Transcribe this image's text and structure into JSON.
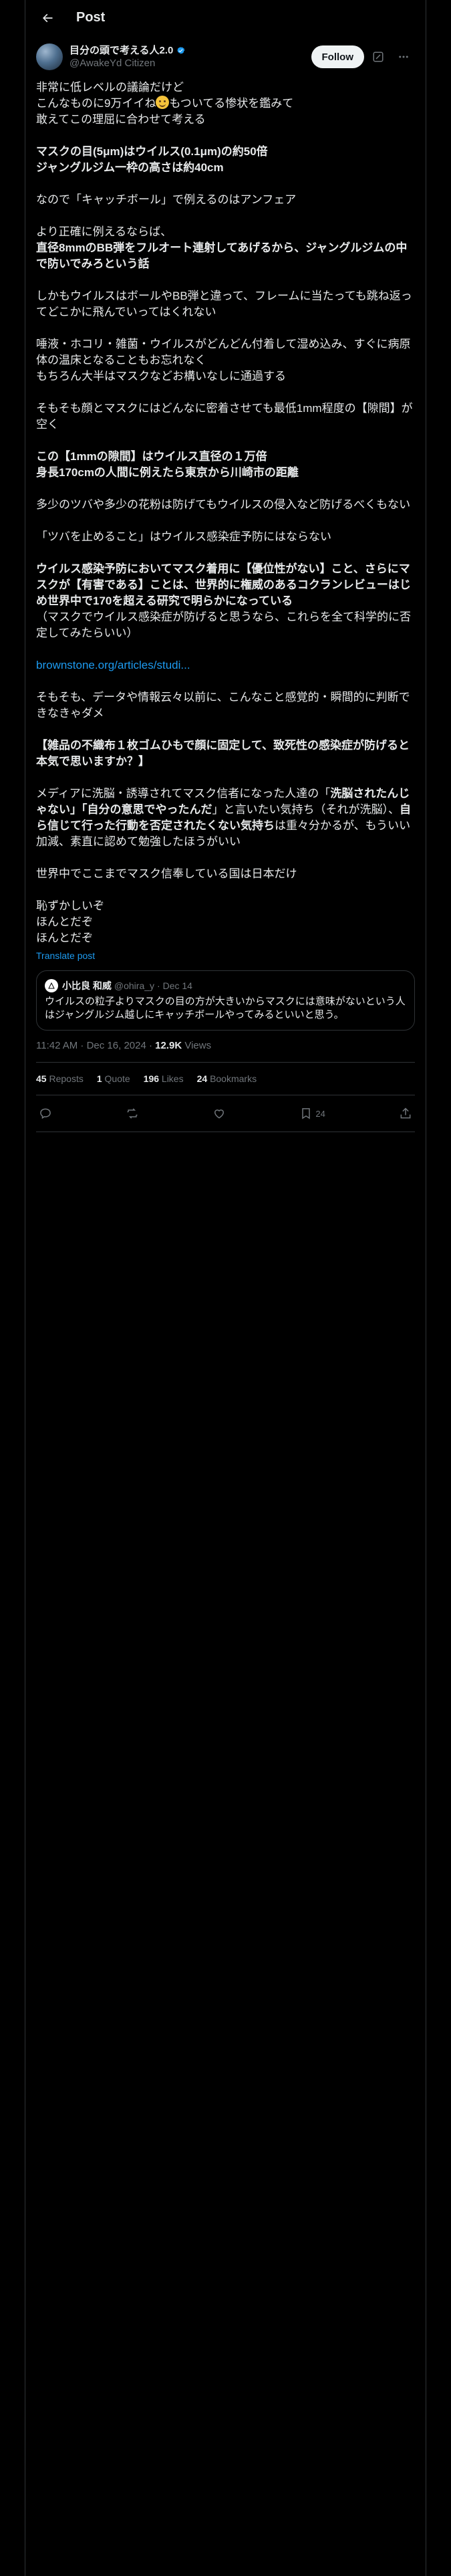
{
  "header": {
    "title": "Post"
  },
  "author": {
    "name": "目分の頭で考える人2.0",
    "handle": "@AwakeYd Citizen"
  },
  "follow_label": "Follow",
  "tweet": {
    "p1_l1": "非常に低レベルの議論だけど",
    "p1_l2a": "こんなものに9万イイね",
    "p1_l2b": "もついてる惨状を鑑みて",
    "p1_l3": "敢えてこの理屈に合わせて考える",
    "p2_l1": "マスクの目(5μm)はウイルス(0.1μm)の約50倍",
    "p2_l2": "ジャングルジム一枠の高さは約40cm",
    "p3": "なので「キャッチボール」で例えるのはアンフェア",
    "p4_l1": "より正確に例えるならば、",
    "p4_l2": "直径8mmのBB弾をフルオート連射してあげるから、ジャングルジムの中で防いでみろという話",
    "p5": "しかもウイルスはボールやBB弾と違って、フレームに当たっても跳ね返ってどこかに飛んでいってはくれない",
    "p6_l1": "唾液・ホコリ・雑菌・ウイルスがどんどん付着して湿め込み、すぐに病原体の温床となることもお忘れなく",
    "p6_l2": "もちろん大半はマスクなどお構いなしに通過する",
    "p7": "そもそも顔とマスクにはどんなに密着させても最低1mm程度の【隙間】が空く",
    "p8_l1": "この【1mmの隙間】はウイルス直径の１万倍",
    "p8_l2": "身長170cmの人間に例えたら東京から川崎市の距離",
    "p9": "多少のツバや多少の花粉は防げてもウイルスの侵入など防げるべくもない",
    "p10": "「ツバを止めること」はウイルス感染症予防にはならない",
    "p11_l1": "ウイルス感染予防においてマスク着用に【優位性がない】こと、さらにマスクが【有害である】ことは、世界的に権威のあるコクランレビューはじめ世界中で170を超える研究で明らかになっている",
    "p11_l2": "（マスクでウイルス感染症が防げると思うなら、これらを全て科学的に否定してみたらいい）",
    "link": "brownstone.org/articles/studi...",
    "p12": "そもそも、データや情報云々以前に、こんなこと感覚的・瞬間的に判断できなきゃダメ",
    "p13": "【雑品の不織布１枚ゴムひもで顔に固定して、致死性の感染症が防げると本気で思いますか？】",
    "p14a": "メディアに洗脳・誘導されてマスク信者になった人達の「",
    "p14b": "洗脳されたんじゃない」「自分の意思でやったんだ",
    "p14c": "」と言いたい気持ち（それが洗脳）、",
    "p14d": "自ら信じて行った行動を否定されたくない気持ち",
    "p14e": "は重々分かるが、もういい加減、素直に認めて勉強したほうがいい",
    "p15": "世界中でここまでマスク信奉している国は日本だけ",
    "p16_l1": "恥ずかしいぞ",
    "p16_l2": "ほんとだぞ",
    "p16_l3": "ほんとだぞ"
  },
  "translate_label": "Translate post",
  "quote": {
    "name": "小比良 和威",
    "handle": "@ohira_y",
    "date": "· Dec 14",
    "text": "ウイルスの粒子よりマスクの目の方が大きいからマスクには意味がないという人はジャングルジム越しにキャッチボールやってみるといいと思う。"
  },
  "meta": {
    "time": "11:42 AM · Dec 16, 2024 · ",
    "views_num": "12.9K",
    "views_label": " Views"
  },
  "stats": {
    "reposts_num": "45",
    "reposts_label": "Reposts",
    "quotes_num": "1",
    "quotes_label": "Quote",
    "likes_num": "196",
    "likes_label": "Likes",
    "bookmarks_num": "24",
    "bookmarks_label": "Bookmarks"
  },
  "actions": {
    "bookmark_count": "24"
  },
  "icons": [
    "back-arrow-icon",
    "verified-badge-icon",
    "grok-icon",
    "more-icon",
    "reply-icon",
    "repost-icon",
    "like-icon",
    "bookmark-icon",
    "share-icon"
  ],
  "colors": {
    "background": "#000000",
    "text": "#e7e9ea",
    "muted": "#71767b",
    "accent": "#1d9bf0",
    "border": "#2f3336"
  }
}
